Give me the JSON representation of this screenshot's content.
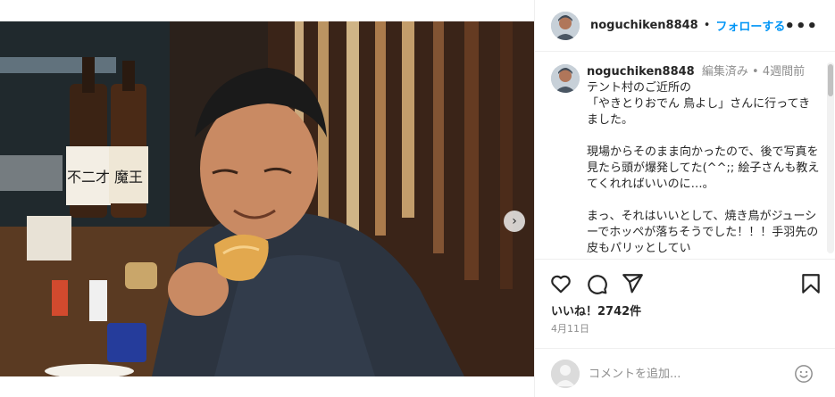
{
  "post": {
    "username": "noguchiken8848",
    "follow_label": "フォローする",
    "separator": "•",
    "more_label": "•••",
    "caption": {
      "username": "noguchiken8848",
      "edited": "編集済み",
      "separator": "•",
      "time": "4週間前",
      "text": "テント村のご近所の\n「やきとりおでん 鳥よし」さんに行ってきました。\n\n現場からそのまま向かったので、後で写真を見たら頭が爆発してた(^^;; 絵子さんも教えてくれればいいのに…。\n\nまっ、それはいいとして、焼き鳥がジューシーでホッペが落ちそうでした！！！手羽先の皮もパリッとしてい"
    },
    "likes_label": "いいね！2742件",
    "date": "4月11日",
    "comment_placeholder": "コメントを追加...",
    "icons": {
      "like": "heart-icon",
      "comment": "comment-icon",
      "share": "share-icon",
      "save": "bookmark-icon",
      "next": "chevron-right-icon",
      "emoji": "emoji-icon"
    },
    "carousel": {
      "count": 7,
      "active": 0
    },
    "bottle_labels": [
      "不二才",
      "魔王"
    ],
    "colors": {
      "accent": "#0095f6",
      "muted": "#8e8e8e",
      "text": "#262626"
    }
  }
}
